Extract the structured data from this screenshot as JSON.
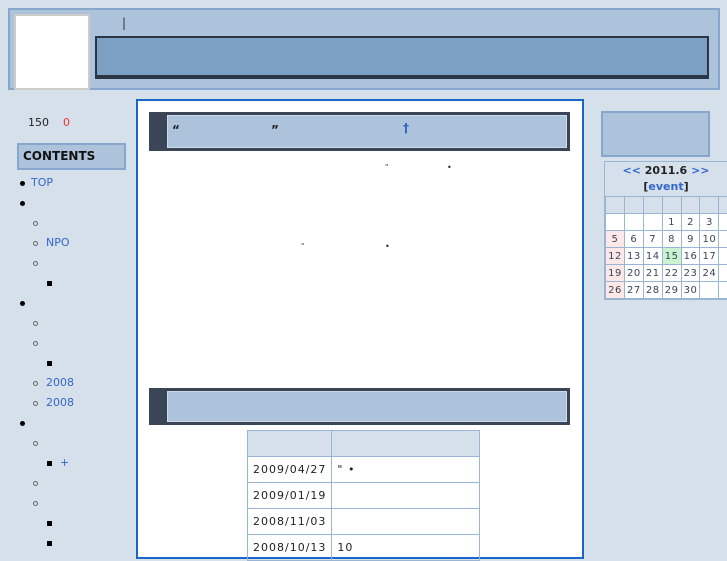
{
  "header": {
    "pipe": "|"
  },
  "sidebar": {
    "visitor_count": "150",
    "today_count": "0",
    "contents_title": "CONTENTS",
    "items": [
      {
        "level": 1,
        "label": "TOP"
      },
      {
        "level": 1,
        "label": ""
      },
      {
        "level": 2,
        "label": ""
      },
      {
        "level": 2,
        "label": "NPO"
      },
      {
        "level": 2,
        "label": ""
      },
      {
        "level": 3,
        "label": ""
      },
      {
        "level": 1,
        "label": ""
      },
      {
        "level": 2,
        "label": ""
      },
      {
        "level": 2,
        "label": ""
      },
      {
        "level": 3,
        "label": ""
      },
      {
        "level": 2,
        "label": "2008"
      },
      {
        "level": 2,
        "label": "2008"
      },
      {
        "level": 1,
        "label": ""
      },
      {
        "level": 2,
        "label": ""
      },
      {
        "level": 3,
        "label": "+"
      },
      {
        "level": 2,
        "label": ""
      },
      {
        "level": 2,
        "label": ""
      },
      {
        "level": 3,
        "label": ""
      },
      {
        "level": 3,
        "label": ""
      }
    ]
  },
  "main": {
    "heading1": {
      "open_quote": "“",
      "close_quote": "”",
      "dagger": "†"
    },
    "para1": {
      "q": "\"",
      "dot": "•"
    },
    "para2": {
      "q": "\"",
      "dot": "•"
    },
    "news": {
      "rows": [
        {
          "date": "2009/04/27",
          "text": "\"            •"
        },
        {
          "date": "2009/01/19",
          "text": ""
        },
        {
          "date": "2008/11/03",
          "text": ""
        },
        {
          "date": "2008/10/13",
          "text": "10"
        }
      ]
    }
  },
  "calendar": {
    "prev": "<<",
    "title": "2011.6",
    "next": ">>",
    "event_label": "event",
    "today": 15,
    "weeks": [
      [
        "",
        "",
        "",
        "1",
        "2",
        "3"
      ],
      [
        "5",
        "6",
        "7",
        "8",
        "9",
        "10"
      ],
      [
        "12",
        "13",
        "14",
        "15",
        "16",
        "17"
      ],
      [
        "19",
        "20",
        "21",
        "22",
        "23",
        "24"
      ],
      [
        "26",
        "27",
        "28",
        "29",
        "30",
        ""
      ]
    ]
  },
  "colors": {
    "accent": "#1a66c8",
    "header": "#adc3db",
    "dark": "#3a4558",
    "link": "#3366cc"
  }
}
